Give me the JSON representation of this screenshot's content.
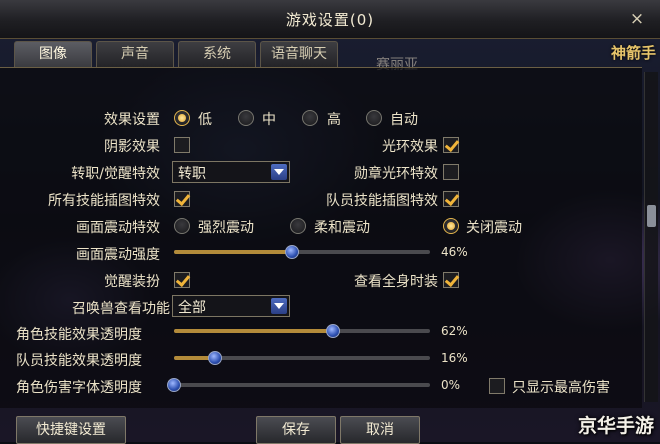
{
  "window": {
    "title": "游戏设置(0)",
    "close_icon": "×"
  },
  "background": {
    "name_text": "赛丽亚",
    "right_edge_text": "神箭手"
  },
  "tabs": [
    {
      "label": "图像",
      "active": true
    },
    {
      "label": "声音",
      "active": false
    },
    {
      "label": "系统",
      "active": false
    },
    {
      "label": "语音聊天",
      "active": false
    }
  ],
  "effect": {
    "label": "效果设置",
    "options": [
      "低",
      "中",
      "高",
      "自动"
    ],
    "selected": "低"
  },
  "shadow": {
    "label": "阴影效果",
    "checked": false
  },
  "halo": {
    "label": "光环效果",
    "checked": true
  },
  "awaken_effect": {
    "label": "转职/觉醒特效",
    "value": "转职"
  },
  "medal_glow": {
    "label": "勋章光环特效",
    "checked": false
  },
  "all_skill_art": {
    "label": "所有技能插图特效",
    "checked": true
  },
  "team_skill_art": {
    "label": "队员技能插图特效",
    "checked": true
  },
  "shake": {
    "label": "画面震动特效",
    "options": [
      "强烈震动",
      "柔和震动",
      "关闭震动"
    ],
    "selected": "关闭震动"
  },
  "shake_strength": {
    "label": "画面震动强度",
    "percent": 46,
    "value_text": "46%"
  },
  "awaken_outfit": {
    "label": "觉醒装扮",
    "checked": true
  },
  "view_full_outfit": {
    "label": "查看全身时装",
    "checked": true
  },
  "pet_view": {
    "label": "召唤兽查看功能",
    "value": "全部"
  },
  "char_skill_alpha": {
    "label": "角色技能效果透明度",
    "percent": 62,
    "value_text": "62%"
  },
  "team_skill_alpha": {
    "label": "队员技能效果透明度",
    "percent": 16,
    "value_text": "16%"
  },
  "char_damage_alpha": {
    "label": "角色伤害字体透明度",
    "percent": 0,
    "value_text": "0%"
  },
  "highest_damage_only": {
    "label": "只显示最高伤害",
    "checked": false
  },
  "buttons": {
    "shortcut": "快捷键设置",
    "save": "保存",
    "cancel": "取消"
  },
  "watermark": "京华手游",
  "colors": {
    "accent_gold": "#e3a52d",
    "slider_fill": "#b38b3a",
    "knob_blue": "#2c4fb0"
  }
}
